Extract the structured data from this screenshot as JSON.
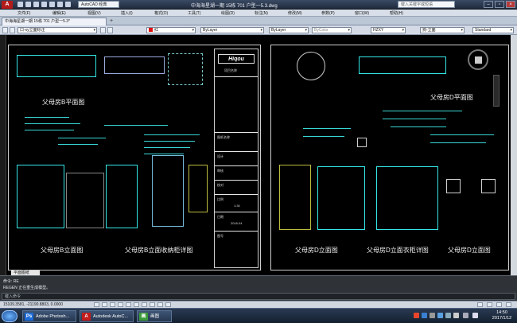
{
  "window": {
    "workspace": "AutoCAD 经典",
    "title": "中海海星湖一期 15栋 701 户型一5.3.dwg",
    "search_placeholder": "键入关键字或短语",
    "app_letter": "A"
  },
  "menu": {
    "items": [
      "文件(F)",
      "编辑(E)",
      "视图(V)",
      "插入(I)",
      "格式(O)",
      "工具(T)",
      "绘图(D)",
      "标注(N)",
      "修改(M)",
      "参数(P)",
      "窗口(W)",
      "帮助(H)"
    ]
  },
  "tabs": {
    "document": "中海海星湖一期 15栋 701 户型一5.3*"
  },
  "toolbar": {
    "layer": "口-xy立面标注",
    "color": "红",
    "linetype": "ByLayer",
    "lineweight": "ByLayer",
    "plotstyle": "ByColor",
    "textstyle": "HZXY",
    "dimstyle": "狗-立面",
    "tablestyle": "Standard"
  },
  "drawing": {
    "left_sheet": {
      "titles": [
        "父母房B平面图",
        "父母房B立面图",
        "父母房B立面收纳柜详图"
      ],
      "title_block": {
        "logo": "Hiqou",
        "project_label": "项目名称",
        "fields": [
          "图纸名称",
          "设计",
          "审核",
          "校对",
          "比例",
          "日期",
          "图号"
        ],
        "scale": "1:30",
        "date": "2016.04"
      }
    },
    "right_sheet": {
      "titles": [
        "父母房D平面图",
        "父母房D立面图",
        "父母房D立面衣柜详图"
      ]
    },
    "layout_tab": "平面图纸"
  },
  "command": {
    "lines": [
      "命令: RE",
      "REGEN 正在重生成模型。"
    ],
    "prompt": "键入命令"
  },
  "status": {
    "coords": "15109.3581, -21190.8803, 0.0000"
  },
  "taskbar": {
    "apps": [
      {
        "label": "Adobe Photosh...",
        "icon": "Ps",
        "color": "#1d6bd6"
      },
      {
        "label": "Autodesk AutoC...",
        "icon": "A",
        "color": "#c21d1d"
      },
      {
        "label": "画图",
        "icon": "画",
        "color": "#3a9a3a"
      }
    ],
    "time": "14:50",
    "date": "2017/1/12"
  }
}
